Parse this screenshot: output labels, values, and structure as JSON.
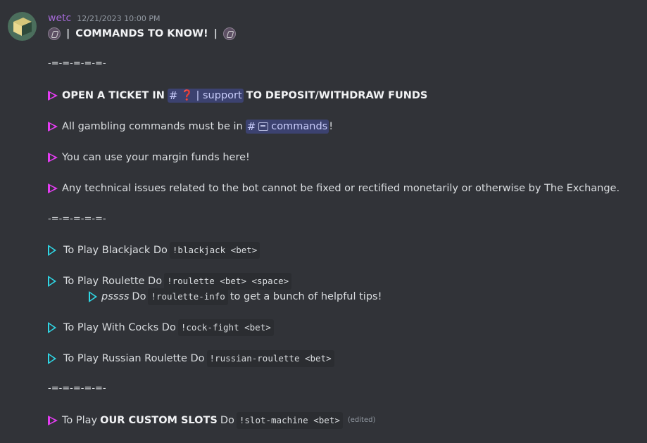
{
  "message": {
    "username": "wetc",
    "timestamp": "12/21/2023 10:00 PM",
    "title": "COMMANDS TO KNOW!",
    "separator": "-=-=-=-=-=-",
    "edited": "(edited)"
  },
  "announcements": [
    {
      "pre": "OPEN A TICKET IN",
      "channel_hash": "#",
      "channel_emoji": "❓",
      "channel_name": "| support",
      "post": "TO DEPOSIT/WITHDRAW FUNDS"
    },
    {
      "pre": "All gambling commands must be in",
      "channel_hash": "#",
      "channel_name": "commands",
      "post": "!"
    },
    {
      "text": "You can use your margin funds here!"
    },
    {
      "text": "Any technical issues related to the bot cannot be fixed or rectified monetarily or otherwise by The Exchange."
    }
  ],
  "games": [
    {
      "text": "To Play Blackjack Do",
      "command": "!blackjack <bet>"
    },
    {
      "text": "To Play Roulette Do",
      "command": "!roulette <bet> <space>"
    },
    {
      "italic": "pssss",
      "text": "Do",
      "command": "!roulette-info",
      "post": "to get a bunch of helpful tips!"
    },
    {
      "text": "To Play With Cocks Do",
      "command": "!cock-fight <bet>"
    },
    {
      "text": "To Play Russian Roulette Do",
      "command": "!russian-roulette <bet>"
    }
  ],
  "slots": {
    "pre": "To Play",
    "bold": "OUR CUSTOM SLOTS",
    "post": "Do",
    "command": "!slot-machine <bet>"
  },
  "colors": {
    "background": "#313338",
    "username": "#a56ad8",
    "purple_arrow": "#e43cf2",
    "cyan_arrow": "#2fd6e4",
    "mention_bg": "#3c4270"
  }
}
